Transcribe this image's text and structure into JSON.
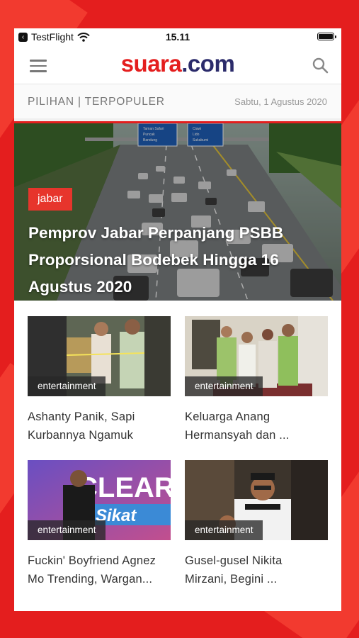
{
  "status_bar": {
    "back_app": "TestFlight",
    "time": "15.11"
  },
  "header": {
    "logo_part1": "su",
    "logo_part2": "ara",
    "logo_part3": ".com"
  },
  "subnav": {
    "tab1": "PILIHAN",
    "separator": " | ",
    "tab2": "TERPOPULER",
    "date": "Sabtu, 1 Agustus 2020"
  },
  "hero": {
    "category": "jabar",
    "title": "Pemprov Jabar Perpanjang PSBB Proporsional Bodebek Hingga 16 Agustus 2020",
    "sign_left": [
      "Taman Safari",
      "Puncak",
      "Bandung"
    ],
    "sign_right": [
      "Ciawi",
      "Lido",
      "Sukabumi"
    ]
  },
  "articles": [
    {
      "category": "entertainment",
      "title_line1": "Ashanty Panik, Sapi",
      "title_line2": "Kurbannya Ngamuk"
    },
    {
      "category": "entertainment",
      "title_line1": "Keluarga Anang",
      "title_line2": "Hermansyah dan ..."
    },
    {
      "category": "entertainment",
      "title_line1": "Fuckin' Boyfriend Agnez",
      "title_line2": "Mo Trending, Wargan...",
      "thumb_text1": "CLEAR",
      "thumb_text2": "Sikat"
    },
    {
      "category": "entertainment",
      "title_line1": "Gusel-gusel Nikita",
      "title_line2": "Mirzani, Begini ..."
    }
  ],
  "colors": {
    "brand_red": "#e41e1e",
    "brand_navy": "#2b2b6b",
    "badge_red": "#e7352c"
  }
}
